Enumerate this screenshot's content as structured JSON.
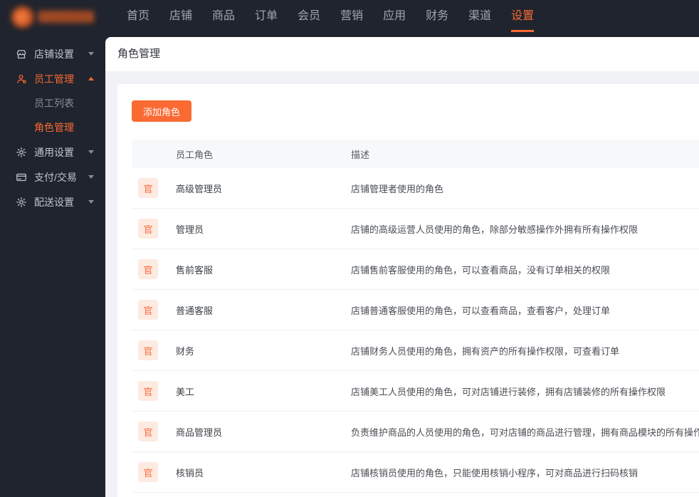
{
  "accent": "#fa6a32",
  "topnav": {
    "items": [
      {
        "label": "首页",
        "active": false
      },
      {
        "label": "店铺",
        "active": false
      },
      {
        "label": "商品",
        "active": false
      },
      {
        "label": "订单",
        "active": false
      },
      {
        "label": "会员",
        "active": false
      },
      {
        "label": "营销",
        "active": false
      },
      {
        "label": "应用",
        "active": false
      },
      {
        "label": "财务",
        "active": false
      },
      {
        "label": "渠道",
        "active": false
      },
      {
        "label": "设置",
        "active": true
      }
    ]
  },
  "sidebar": {
    "items": [
      {
        "label": "店铺设置",
        "icon": "shop",
        "chevron": "down",
        "active": false
      },
      {
        "label": "员工管理",
        "icon": "users",
        "chevron": "up",
        "active": true,
        "children": [
          {
            "label": "员工列表",
            "active": false
          },
          {
            "label": "角色管理",
            "active": true
          }
        ]
      },
      {
        "label": "通用设置",
        "icon": "gear",
        "chevron": "down",
        "active": false
      },
      {
        "label": "支付/交易",
        "icon": "card",
        "chevron": "down",
        "active": false
      },
      {
        "label": "配送设置",
        "icon": "gear",
        "chevron": "down",
        "active": false
      }
    ]
  },
  "page": {
    "title": "角色管理"
  },
  "toolbar": {
    "add_role_label": "添加角色"
  },
  "table": {
    "columns": {
      "role": "员工角色",
      "desc": "描述"
    },
    "badge_text": "官",
    "rows": [
      {
        "role": "高级管理员",
        "desc": "店铺管理者使用的角色"
      },
      {
        "role": "管理员",
        "desc": "店铺的高级运营人员使用的角色，除部分敏感操作外拥有所有操作权限"
      },
      {
        "role": "售前客服",
        "desc": "店铺售前客服使用的角色，可以查看商品，没有订单相关的权限"
      },
      {
        "role": "普通客服",
        "desc": "店铺普通客服使用的角色，可以查看商品，查看客户，处理订单"
      },
      {
        "role": "财务",
        "desc": "店铺财务人员使用的角色，拥有资产的所有操作权限，可查看订单"
      },
      {
        "role": "美工",
        "desc": "店铺美工人员使用的角色，可对店铺进行装修，拥有店铺装修的所有操作权限"
      },
      {
        "role": "商品管理员",
        "desc": "负责维护商品的人员使用的角色，可对店铺的商品进行管理，拥有商品模块的所有操作权限"
      },
      {
        "role": "核销员",
        "desc": "店铺核销员使用的角色，只能使用核销小程序，可对商品进行扫码核销"
      }
    ]
  }
}
